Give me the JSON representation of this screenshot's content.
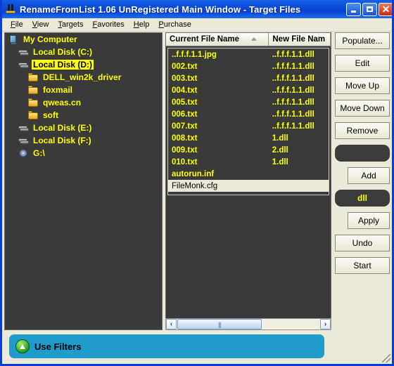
{
  "window": {
    "title": "RenameFromList 1.06 UnRegistered Main Window - Target Files",
    "icon": "app-icon",
    "minimize_label": "_",
    "maximize_label": "",
    "close_label": "✕"
  },
  "menu": {
    "items": [
      {
        "label": "File",
        "accel": "F"
      },
      {
        "label": "View",
        "accel": "V"
      },
      {
        "label": "Targets",
        "accel": "T"
      },
      {
        "label": "Favorites",
        "accel": "F"
      },
      {
        "label": "Help",
        "accel": "H"
      },
      {
        "label": "Purchase",
        "accel": "P"
      }
    ]
  },
  "tree": {
    "items": [
      {
        "label": "My Computer",
        "icon": "computer-icon",
        "indent": 0,
        "selected": false
      },
      {
        "label": "Local Disk (C:)",
        "icon": "disk-icon",
        "indent": 1,
        "selected": false
      },
      {
        "label": "Local Disk (D:)",
        "icon": "disk-icon",
        "indent": 1,
        "selected": true
      },
      {
        "label": "DELL_win2k_driver",
        "icon": "folder-icon",
        "indent": 2,
        "selected": false
      },
      {
        "label": "foxmail",
        "icon": "folder-icon",
        "indent": 2,
        "selected": false
      },
      {
        "label": "qweas.cn",
        "icon": "folder-icon",
        "indent": 2,
        "selected": false
      },
      {
        "label": "soft",
        "icon": "folder-icon",
        "indent": 2,
        "selected": false
      },
      {
        "label": "Local Disk (E:)",
        "icon": "disk-icon",
        "indent": 1,
        "selected": false
      },
      {
        "label": "Local Disk (F:)",
        "icon": "disk-icon",
        "indent": 1,
        "selected": false
      },
      {
        "label": "G:\\",
        "icon": "cd-icon",
        "indent": 1,
        "selected": false
      }
    ]
  },
  "filelist": {
    "columns": [
      {
        "label": "Current File Name",
        "sort": "ascending"
      },
      {
        "label": "New File Nam",
        "sort": "none"
      }
    ],
    "rows": [
      {
        "current": "..f.f.f.1.1.jpg",
        "new": "..f.f.f.1.1.dll",
        "selected": false
      },
      {
        "current": "002.txt",
        "new": "..f.f.f.1.1.dll",
        "selected": false
      },
      {
        "current": "003.txt",
        "new": "..f.f.f.1.1.dll",
        "selected": false
      },
      {
        "current": "004.txt",
        "new": "..f.f.f.1.1.dll",
        "selected": false
      },
      {
        "current": "005.txt",
        "new": "..f.f.f.1.1.dll",
        "selected": false
      },
      {
        "current": "006.txt",
        "new": "..f.f.f.1.1.dll",
        "selected": false
      },
      {
        "current": "007.txt",
        "new": "..f.f.f.1.1.dll",
        "selected": false
      },
      {
        "current": "008.txt",
        "new": "1.dll",
        "selected": false
      },
      {
        "current": "009.txt",
        "new": "2.dll",
        "selected": false
      },
      {
        "current": "010.txt",
        "new": "1.dll",
        "selected": false
      },
      {
        "current": "autorun.inf",
        "new": "",
        "selected": false
      },
      {
        "current": "FileMonk.cfg",
        "new": "",
        "selected": true
      }
    ],
    "scrollbar": {
      "left_arrow": "‹",
      "right_arrow": "›",
      "thumb_grip": "|||"
    }
  },
  "actions": {
    "populate": "Populate...",
    "edit": "Edit",
    "move_up": "Move Up",
    "move_down": "Move Down",
    "remove": "Remove",
    "filter_field_value": "",
    "add": "Add",
    "extension_field_value": "dll",
    "apply": "Apply",
    "undo": "Undo",
    "start": "Start"
  },
  "filters": {
    "label": "Use Filters",
    "icon": "up-arrow-icon"
  },
  "colors": {
    "titlebar": "#0a3ed8",
    "panel_bg": "#3a3a3a",
    "text_yellow": "#ffff00",
    "face": "#ece9d8",
    "filter_bar": "#1f9ccb"
  }
}
